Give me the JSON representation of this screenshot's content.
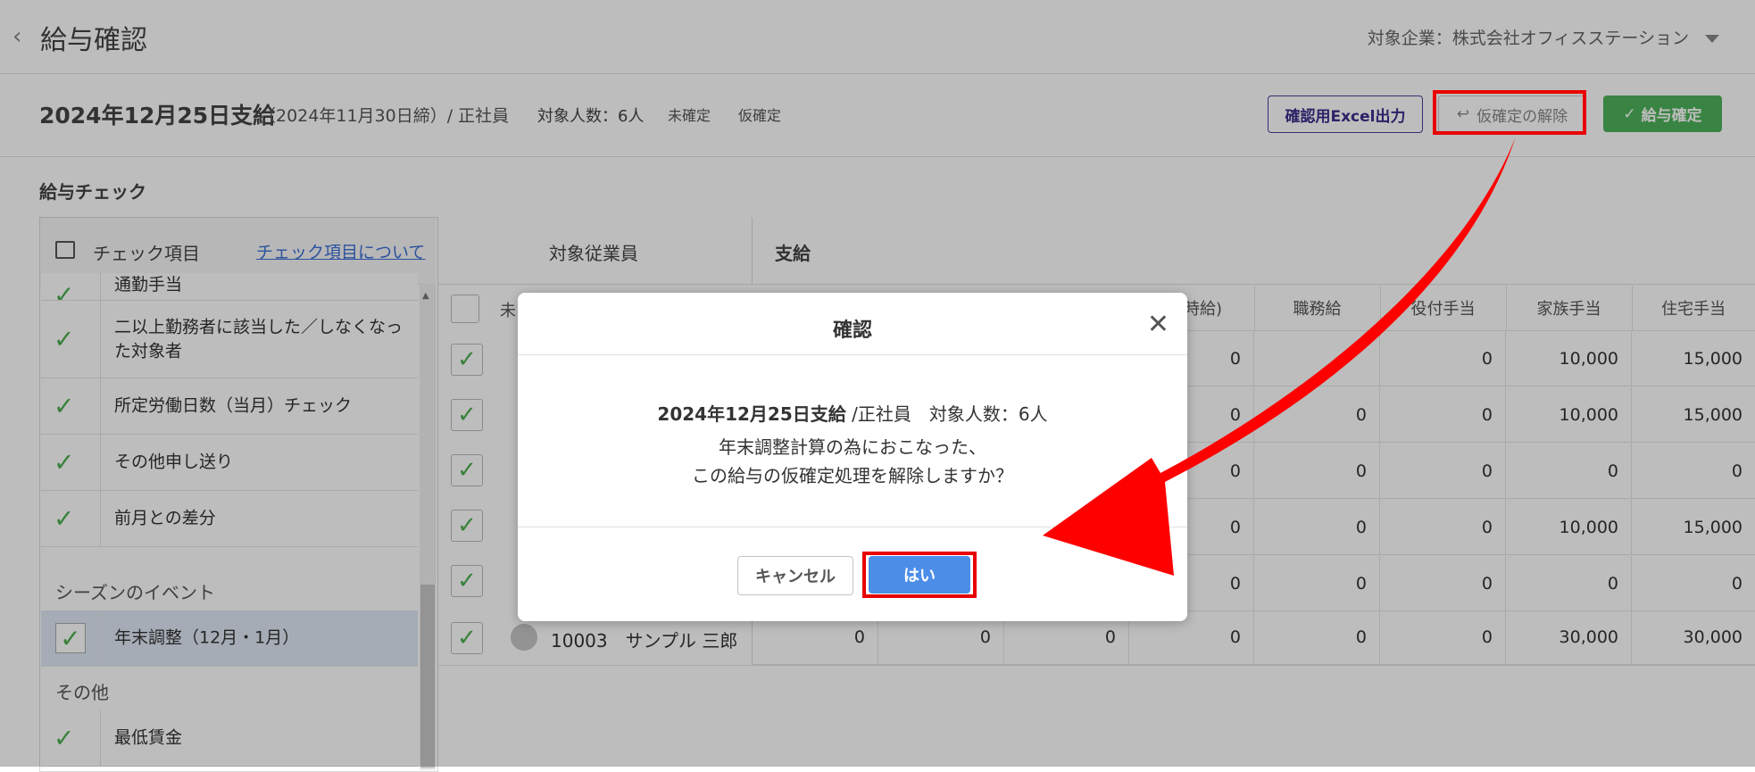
{
  "header": {
    "back_icon": "chevron-left-icon",
    "title": "給与確認",
    "company_label": "対象企業：株式会社オフィスステーション"
  },
  "payroll": {
    "pay_date": "2024年12月25日支給",
    "closing": "（2024年11月30日締）/ 正社員",
    "target_count": "対象人数：6人",
    "status_unconfirmed": "未確定",
    "status_provisional": "仮確定",
    "excel_button": "確認用Excel出力",
    "release_button": "仮確定の解除",
    "confirm_button": "給与確定"
  },
  "check_section": {
    "title": "給与チェック",
    "items_header": "チェック項目",
    "about_link": "チェック項目について",
    "items": [
      {
        "label": "通勤手当"
      },
      {
        "label": "二以上勤務者に該当した／しなくなった対象者"
      },
      {
        "label": "所定労働日数（当月）チェック"
      },
      {
        "label": "その他申し送り"
      },
      {
        "label": "前月との差分"
      }
    ],
    "season_group": "シーズンのイベント",
    "season_item": "年末調整（12月・1月）",
    "other_group": "その他",
    "other_item": "最低賃金"
  },
  "grid": {
    "employee_header": "対象従業員",
    "employee_subheader": "未",
    "pay_header": "支給",
    "columns": [
      "給(時給)",
      "職務給",
      "役付手当",
      "家族手当",
      "住宅手当"
    ],
    "rows": [
      [
        "0",
        "",
        "0",
        "10,000",
        "15,000"
      ],
      [
        "0",
        "0",
        "0",
        "10,000",
        "15,000"
      ],
      [
        "0",
        "0",
        "0",
        "0",
        "0"
      ],
      [
        "0",
        "0",
        "0",
        "10,000",
        "15,000"
      ],
      [
        "0",
        "0",
        "0",
        "0",
        "0"
      ]
    ],
    "last_row": {
      "employee": "10003　サンプル 三郎",
      "values": [
        "0",
        "0",
        "0",
        "0",
        "0",
        "0",
        "30,000",
        "30,000"
      ]
    }
  },
  "dialog": {
    "title": "確認",
    "line1_bold": "2024年12月25日支給",
    "line1_rest": " /正社員　対象人数：6人",
    "line2": "年末調整計算の為におこなった、",
    "line3": "この給与の仮確定処理を解除しますか？",
    "cancel": "キャンセル",
    "yes": "はい"
  },
  "colors": {
    "primary": "#4c8de8",
    "confirm_green": "#4db25a",
    "highlight_red": "#e80000",
    "excel_border": "#4a3f9c"
  }
}
